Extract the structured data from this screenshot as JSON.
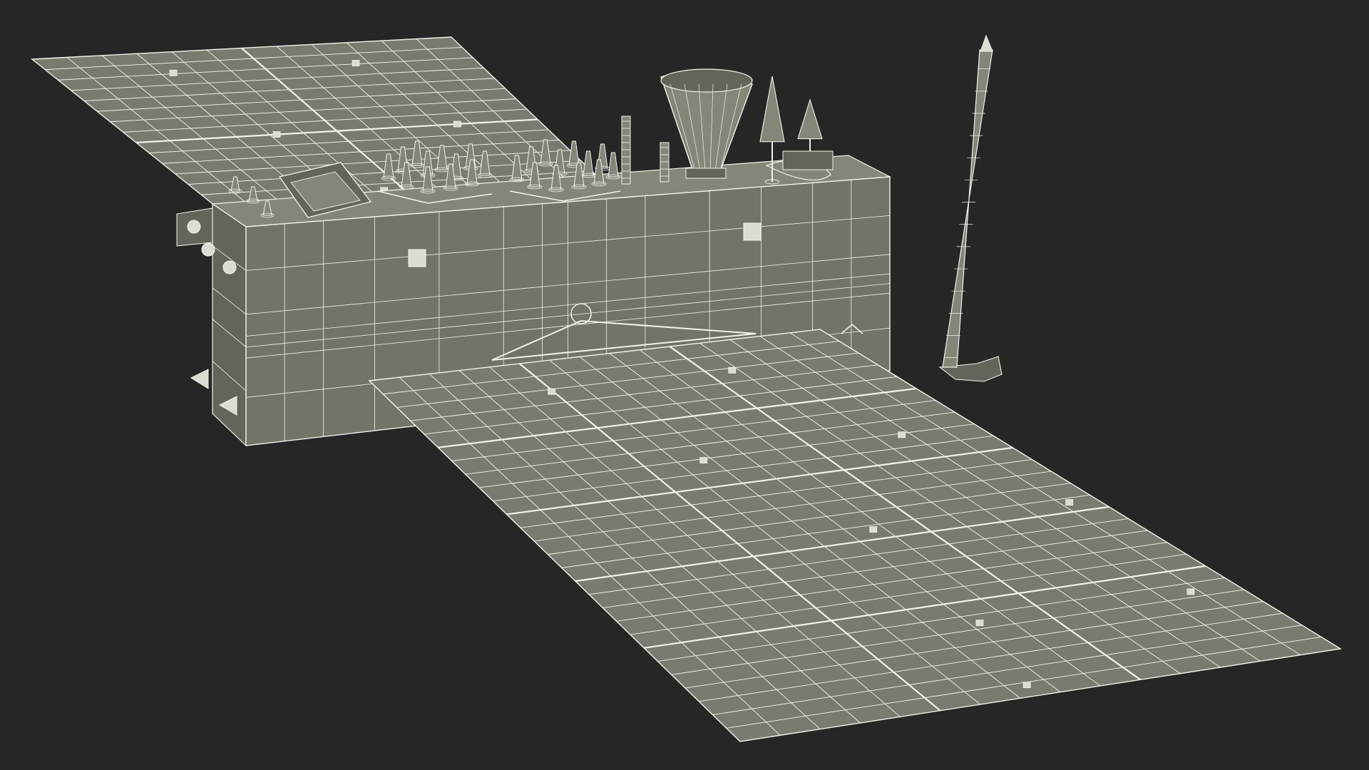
{
  "scene": {
    "subject": "satellite-wireframe-render",
    "colors": {
      "background": "#262626",
      "panel_fill": "#7a7b70",
      "body_fill": "#737468",
      "body_top": "#85867a",
      "body_dark": "#64655a",
      "wire": "#f2f2ea",
      "detail": "#dcdcd2"
    }
  }
}
